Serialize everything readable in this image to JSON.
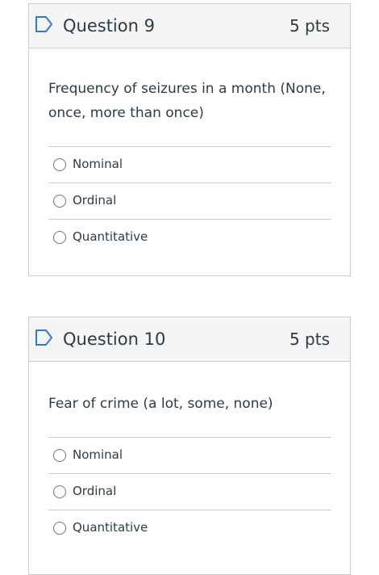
{
  "questions": [
    {
      "title": "Question 9",
      "points": "5 pts",
      "text": "Frequency of seizures in a month (None, once, more than once)",
      "options": [
        "Nominal",
        "Ordinal",
        "Quantitative"
      ]
    },
    {
      "title": "Question 10",
      "points": "5 pts",
      "text": "Fear of crime (a lot, some, none)",
      "options": [
        "Nominal",
        "Ordinal",
        "Quantitative"
      ]
    }
  ],
  "colors": {
    "flag": "#2d7bd6",
    "border": "#c7cdd1",
    "text": "#2d3b45",
    "header_bg": "#f5f5f5"
  }
}
